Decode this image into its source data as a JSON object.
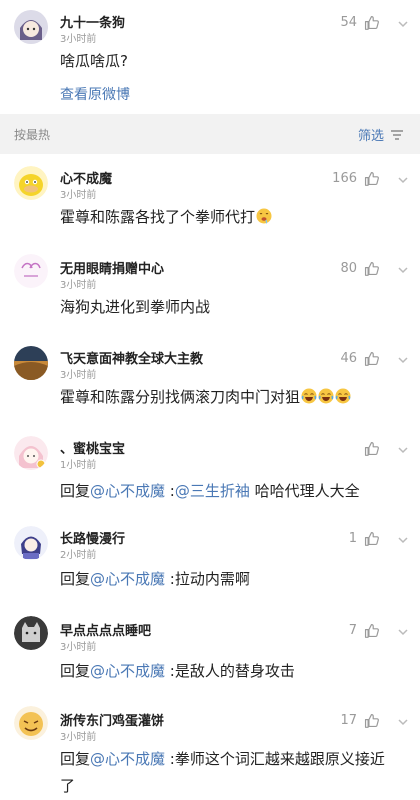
{
  "top_comment": {
    "username": "九十一条狗",
    "time": "3小时前",
    "likes": "54",
    "text": "啥瓜啥瓜?",
    "view_original": "查看原微博"
  },
  "sort_bar": {
    "label": "按最热",
    "filter_label": "筛选"
  },
  "comments": [
    {
      "username": "心不成魔",
      "time": "3小时前",
      "likes": "166",
      "text": "霍尊和陈露各找了个拳师代打"
    },
    {
      "username": "无用眼睛捐赠中心",
      "time": "3小时前",
      "likes": "80",
      "text": "海狗丸进化到拳师内战"
    },
    {
      "username": "飞天意面神教全球大主教",
      "time": "3小时前",
      "likes": "46",
      "text": "霍尊和陈露分别找俩滚刀肉中门对狙"
    },
    {
      "username": "、蜜桃宝宝",
      "time": "1小时前",
      "likes": "",
      "reply_prefix": "回复",
      "mention": "@心不成魔",
      "sep": " :",
      "mention2": "@三生折袖",
      "text": " 哈哈代理人大全"
    },
    {
      "username": "长路慢漫行",
      "time": "2小时前",
      "likes": "1",
      "reply_prefix": "回复",
      "mention": "@心不成魔",
      "sep": " :",
      "text": "拉动内需啊"
    },
    {
      "username": "早点点点点睡吧",
      "time": "3小时前",
      "likes": "7",
      "reply_prefix": "回复",
      "mention": "@心不成魔",
      "sep": " :",
      "text": "是敌人的替身攻击"
    },
    {
      "username": "浙传东门鸡蛋灌饼",
      "time": "3小时前",
      "likes": "17",
      "reply_prefix": "回复",
      "mention": "@心不成魔",
      "sep": " :",
      "text": "拳师这个词汇越来越跟原义接近了"
    }
  ],
  "colors": {
    "link": "#4a78b5",
    "muted": "#9a9a9a",
    "band": "#f2f2f2"
  },
  "icons": [
    "thumbs-up-icon",
    "chevron-down-icon",
    "filter-icon",
    "laugh-cry-emoji-icon",
    "drool-emoji-icon"
  ]
}
